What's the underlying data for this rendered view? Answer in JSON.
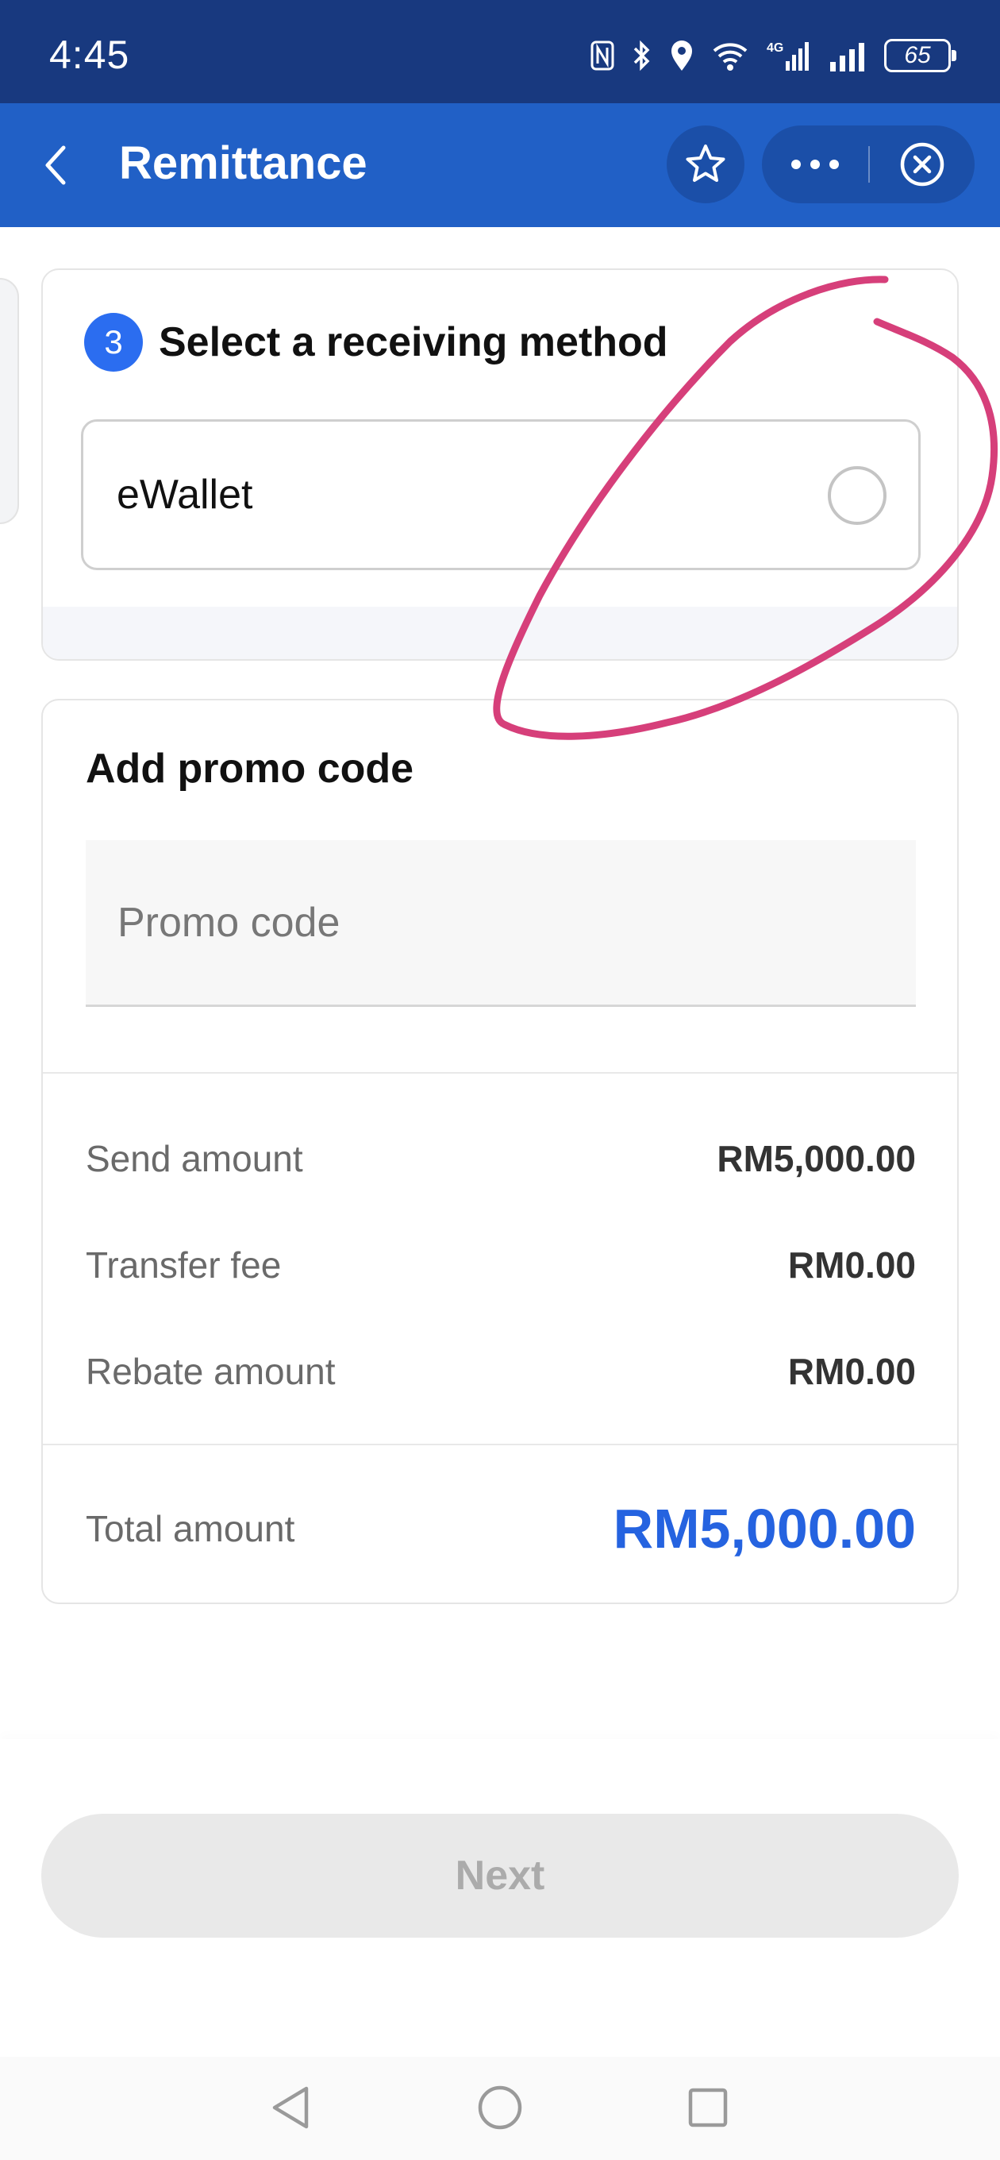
{
  "status_bar": {
    "time": "4:45",
    "battery": "65",
    "network_label": "4G"
  },
  "header": {
    "title": "Remittance",
    "icons": [
      "back-chevron-icon",
      "star-icon",
      "more-dots-icon",
      "close-circle-icon"
    ]
  },
  "receiving_method": {
    "step_number": "3",
    "title": "Select a receiving method",
    "options": [
      {
        "label": "eWallet",
        "selected": false
      }
    ]
  },
  "promo": {
    "title": "Add promo code",
    "placeholder": "Promo code",
    "value": ""
  },
  "summary": {
    "rows": [
      {
        "label": "Send amount",
        "value": "RM5,000.00"
      },
      {
        "label": "Transfer fee",
        "value": "RM0.00"
      },
      {
        "label": "Rebate amount",
        "value": "RM0.00"
      }
    ],
    "total_label": "Total amount",
    "total_value": "RM5,000.00"
  },
  "actions": {
    "next_label": "Next",
    "next_enabled": false
  },
  "colors": {
    "status_bar": "#18397f",
    "header": "#2160c6",
    "accent": "#2563e0",
    "annotation": "#d63f7a"
  }
}
